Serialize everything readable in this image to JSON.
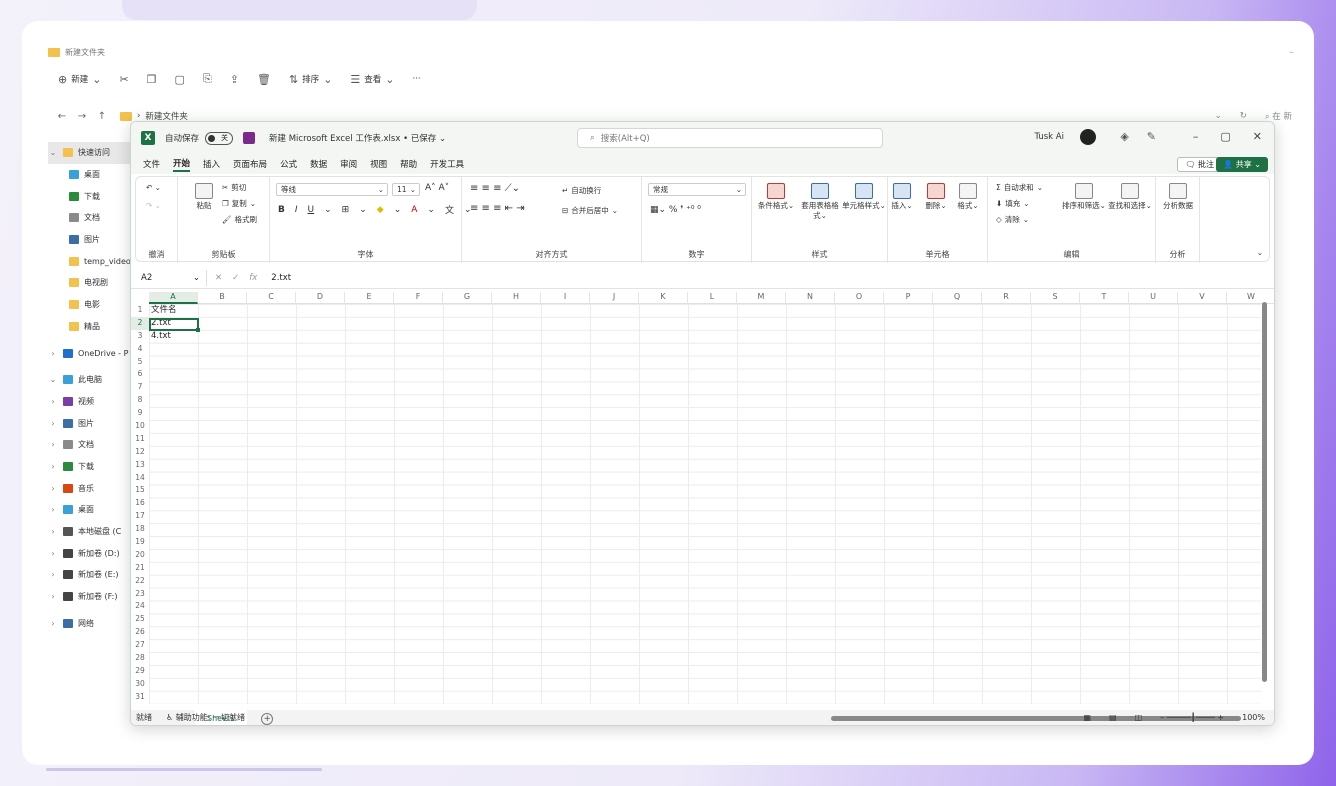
{
  "explorer": {
    "title": "新建文件夹",
    "toolbar": {
      "new_label": "新建",
      "sort_label": "排序",
      "view_label": "查看",
      "more": "···"
    },
    "address": {
      "path": "新建文件夹",
      "search_placeholder": "在 新"
    },
    "sidebar": [
      {
        "label": "快速访问",
        "chev": "⌄",
        "color": "#f2c14e",
        "sel": true
      },
      {
        "label": "桌面",
        "chev": "",
        "color": "#3aa0d8"
      },
      {
        "label": "下载",
        "chev": "",
        "color": "#2b8a3e"
      },
      {
        "label": "文档",
        "chev": "",
        "color": "#8a8a8a"
      },
      {
        "label": "图片",
        "chev": "",
        "color": "#3a6ea5"
      },
      {
        "label": "temp_video",
        "chev": "",
        "color": "#f2c14e"
      },
      {
        "label": "电视剧",
        "chev": "",
        "color": "#f2c14e"
      },
      {
        "label": "电影",
        "chev": "",
        "color": "#f2c14e"
      },
      {
        "label": "精品",
        "chev": "",
        "color": "#f2c14e"
      },
      {
        "label": "OneDrive - P",
        "chev": "›",
        "color": "#1f6fd1"
      },
      {
        "label": "此电脑",
        "chev": "⌄",
        "color": "#3aa0d8"
      },
      {
        "label": "视频",
        "chev": "›",
        "color": "#7a3ea5"
      },
      {
        "label": "图片",
        "chev": "›",
        "color": "#3a6ea5"
      },
      {
        "label": "文档",
        "chev": "›",
        "color": "#8a8a8a"
      },
      {
        "label": "下载",
        "chev": "›",
        "color": "#2b8a3e"
      },
      {
        "label": "音乐",
        "chev": "›",
        "color": "#d9480f"
      },
      {
        "label": "桌面",
        "chev": "›",
        "color": "#3aa0d8"
      },
      {
        "label": "本地磁盘 (C",
        "chev": "›",
        "color": "#555"
      },
      {
        "label": "新加卷 (D:)",
        "chev": "›",
        "color": "#444"
      },
      {
        "label": "新加卷 (E:)",
        "chev": "›",
        "color": "#444"
      },
      {
        "label": "新加卷 (F:)",
        "chev": "›",
        "color": "#444"
      },
      {
        "label": "网络",
        "chev": "›",
        "color": "#3a6ea5"
      }
    ]
  },
  "excel": {
    "autosave_label": "自动保存",
    "toggle_label": "关",
    "doc_title": "新建 Microsoft Excel 工作表.xlsx • 已保存 ⌄",
    "search_placeholder": "搜索(Alt+Q)",
    "user": "Tusk Ai",
    "menu": [
      "文件",
      "开始",
      "插入",
      "页面布局",
      "公式",
      "数据",
      "审阅",
      "视图",
      "帮助",
      "开发工具"
    ],
    "active_menu": "开始",
    "comment_label": "批注",
    "share_label": "共享",
    "ribbon": {
      "undo_group": "撤消",
      "clipboard": {
        "label": "剪贴板",
        "paste": "粘贴",
        "cut": "剪切",
        "copy": "复制",
        "format_painter": "格式刷"
      },
      "font": {
        "label": "字体",
        "name": "等线",
        "size": "11"
      },
      "align": {
        "label": "对齐方式",
        "wrap": "自动换行",
        "merge": "合并后居中"
      },
      "number": {
        "label": "数字",
        "format": "常规"
      },
      "styles": {
        "label": "样式",
        "cond": "条件格式",
        "table": "套用表格格式",
        "cell": "单元格样式"
      },
      "cells": {
        "label": "单元格",
        "insert": "插入",
        "delete": "删除",
        "format": "格式"
      },
      "edit": {
        "label": "编辑",
        "autosum": "自动求和",
        "fill": "填充",
        "clear": "清除",
        "sort": "排序和筛选",
        "find": "查找和选择"
      },
      "analyze": {
        "label": "分析",
        "btn": "分析数据"
      }
    },
    "formula": {
      "namebox": "A2",
      "value": "2.txt"
    },
    "columns": [
      "A",
      "B",
      "C",
      "D",
      "E",
      "F",
      "G",
      "H",
      "I",
      "J",
      "K",
      "L",
      "M",
      "N",
      "O",
      "P",
      "Q",
      "R",
      "S",
      "T",
      "U",
      "V",
      "W"
    ],
    "rows": [
      "1",
      "2",
      "3",
      "4",
      "5",
      "6",
      "7",
      "8",
      "9",
      "10",
      "11",
      "12",
      "13",
      "14",
      "15",
      "16",
      "17",
      "18",
      "19",
      "20",
      "21",
      "22",
      "23",
      "24",
      "25",
      "26",
      "27",
      "28",
      "29",
      "30",
      "31"
    ],
    "cells": [
      "文件名",
      "2.txt",
      "4.txt"
    ],
    "sheet_tab": "Sheet1",
    "status": {
      "ready": "就绪",
      "accessibility": "辅助功能: 一切就绪",
      "zoom": "100%"
    }
  }
}
